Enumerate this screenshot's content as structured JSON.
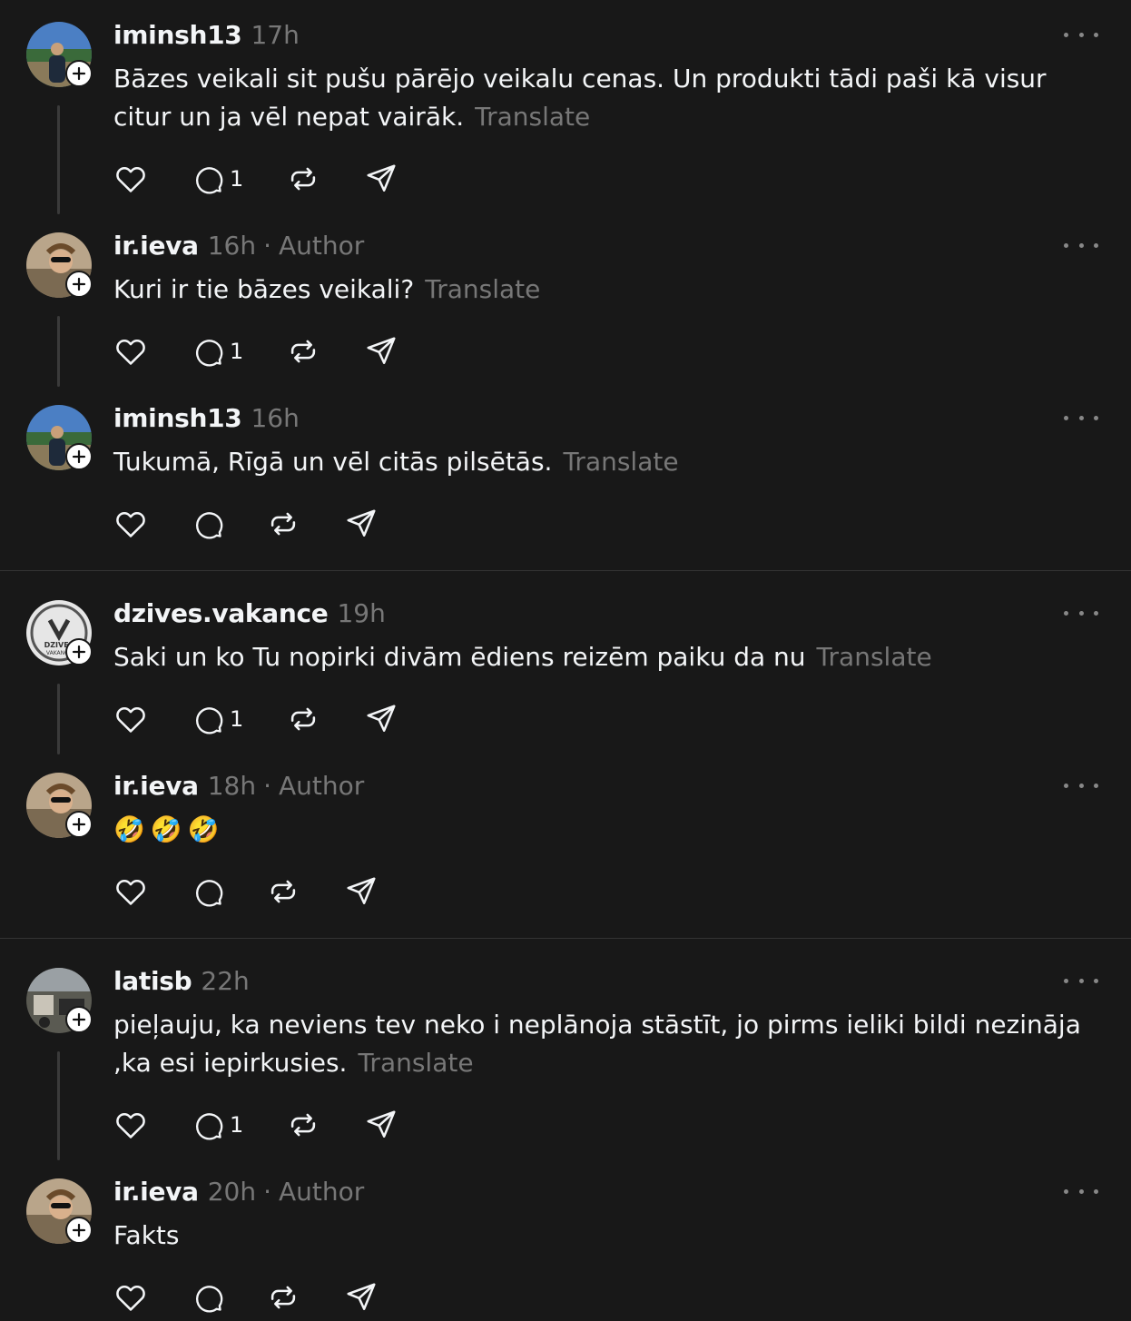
{
  "threads": [
    {
      "posts": [
        {
          "user": "iminsh13",
          "time": "17h",
          "author": "",
          "body": "Bāzes veikali sit pušu pārējo veikalu cenas. Un produkti tādi paši kā visur citur un ja vēl nepat vairāk.",
          "translate": "Translate",
          "reply_count": "1"
        },
        {
          "user": "ir.ieva",
          "time": "16h",
          "author": "Author",
          "body": "Kuri ir tie bāzes veikali?",
          "translate": "Translate",
          "reply_count": "1"
        },
        {
          "user": "iminsh13",
          "time": "16h",
          "author": "",
          "body": "Tukumā, Rīgā un vēl citās pilsētās.",
          "translate": "Translate",
          "reply_count": ""
        }
      ]
    },
    {
      "posts": [
        {
          "user": "dzives.vakance",
          "time": "19h",
          "author": "",
          "body": "Saki un ko Tu nopirki divām ēdiens reizēm paiku da nu",
          "translate": "Translate",
          "reply_count": "1",
          "avatar_text": "DZIVES VAKANCE"
        },
        {
          "user": "ir.ieva",
          "time": "18h",
          "author": "Author",
          "body": "",
          "emoji": [
            "🤣",
            "🤣",
            "🤣"
          ],
          "translate": "",
          "reply_count": ""
        }
      ]
    },
    {
      "posts": [
        {
          "user": "latisb",
          "time": "22h",
          "author": "",
          "body": "pieļauju, ka neviens tev neko i neplānoja stāstīt, jo pirms ieliki bildi nezināja ,ka esi iepirkusies.",
          "translate": "Translate",
          "reply_count": "1"
        },
        {
          "user": "ir.ieva",
          "time": "20h",
          "author": "Author",
          "body": "Fakts",
          "translate": "",
          "reply_count": ""
        }
      ]
    }
  ],
  "separator": "·",
  "icons": [
    "heart-icon",
    "comment-icon",
    "repost-icon",
    "share-icon",
    "more-icon",
    "follow-plus-icon"
  ]
}
